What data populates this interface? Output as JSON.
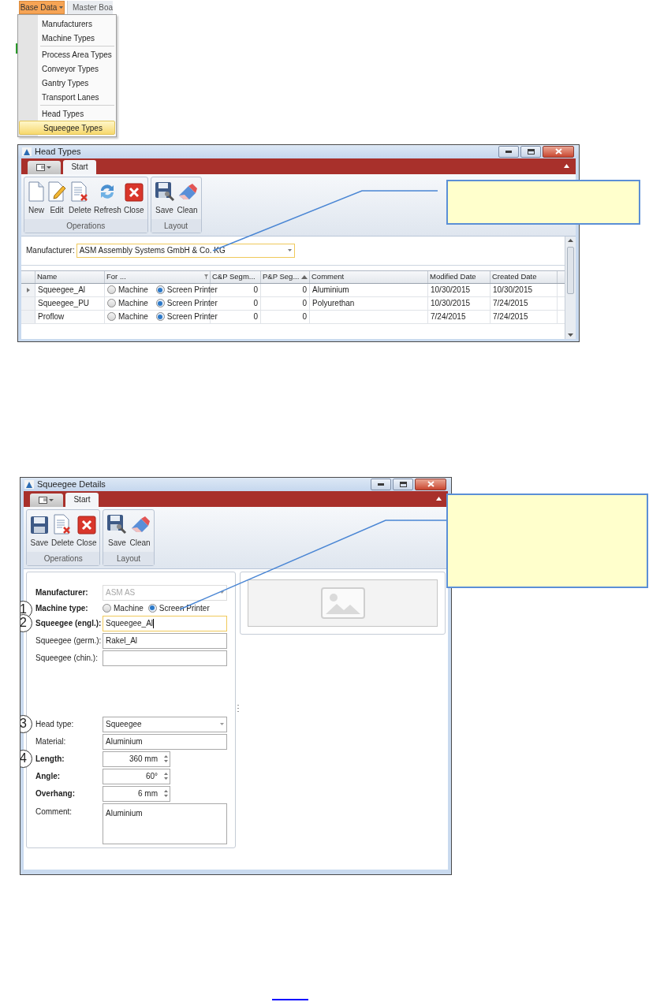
{
  "menu": {
    "button": "Base Data",
    "next_tab": "Master Boa",
    "groups": [
      [
        {
          "label": "Manufacturers",
          "selected": false
        },
        {
          "label": "Machine Types",
          "selected": false
        }
      ],
      [
        {
          "label": "Process Area Types",
          "selected": false
        },
        {
          "label": "Conveyor Types",
          "selected": false
        },
        {
          "label": "Gantry Types",
          "selected": false
        },
        {
          "label": "Transport Lanes",
          "selected": false
        }
      ],
      [
        {
          "label": "Head Types",
          "selected": false
        },
        {
          "label": "Squeegee Types",
          "selected": true
        }
      ]
    ]
  },
  "head_types_window": {
    "title": "Head Types",
    "tab": "Start",
    "ribbon": [
      {
        "label": "Operations",
        "buttons": [
          {
            "label": "New",
            "kind": "new"
          },
          {
            "label": "Edit",
            "kind": "edit"
          },
          {
            "label": "Delete",
            "kind": "delete"
          },
          {
            "label": "Refresh",
            "kind": "refresh"
          },
          {
            "label": "Close",
            "kind": "close"
          }
        ]
      },
      {
        "label": "Layout",
        "buttons": [
          {
            "label": "Save",
            "kind": "save-layout"
          },
          {
            "label": "Clean",
            "kind": "clean"
          }
        ]
      }
    ],
    "manufacturer": {
      "label": "Manufacturer:",
      "value": "ASM Assembly Systems GmbH & Co. KG"
    },
    "table": {
      "columns": [
        {
          "label": "Name",
          "filter": false,
          "sorted": false
        },
        {
          "label": "For ...",
          "filter": true,
          "sorted": false
        },
        {
          "label": "C&P Segm...",
          "filter": false,
          "sorted": false
        },
        {
          "label": "P&P Seg...",
          "filter": false,
          "sorted": true
        },
        {
          "label": "Comment",
          "filter": false,
          "sorted": false
        },
        {
          "label": "Modified Date",
          "filter": false,
          "sorted": false
        },
        {
          "label": "Created Date",
          "filter": false,
          "sorted": false
        }
      ],
      "rows": [
        {
          "current": true,
          "name": "Squeegee_Al",
          "options": [
            {
              "label": "Machine",
              "selected": false
            },
            {
              "label": "Screen Printer",
              "selected": true
            }
          ],
          "cp": "0",
          "pp": "0",
          "comment": "Aluminium",
          "modified": "10/30/2015",
          "created": "10/30/2015"
        },
        {
          "current": false,
          "name": "Squeegee_PU",
          "options": [
            {
              "label": "Machine",
              "selected": false
            },
            {
              "label": "Screen Printer",
              "selected": true
            }
          ],
          "cp": "0",
          "pp": "0",
          "comment": "Polyurethan",
          "modified": "10/30/2015",
          "created": "7/24/2015"
        },
        {
          "current": false,
          "name": "Proflow",
          "options": [
            {
              "label": "Machine",
              "selected": false
            },
            {
              "label": "Screen Printer",
              "selected": true
            }
          ],
          "cp": "0",
          "pp": "0",
          "modified": "7/24/2015",
          "created": "7/24/2015"
        }
      ]
    }
  },
  "details_window": {
    "title": "Squeegee Details",
    "tab": "Start",
    "ribbon": [
      {
        "label": "Operations",
        "buttons": [
          {
            "label": "Save",
            "kind": "save"
          },
          {
            "label": "Delete",
            "kind": "delete"
          },
          {
            "label": "Close",
            "kind": "close"
          }
        ]
      },
      {
        "label": "Layout",
        "buttons": [
          {
            "label": "Save",
            "kind": "save-layout"
          },
          {
            "label": "Clean",
            "kind": "clean"
          }
        ]
      }
    ],
    "sections": [
      [
        {
          "kind": "dropdown",
          "label": "Manufacturer:",
          "bold": true,
          "value": "ASM AS",
          "disabled": true
        },
        {
          "kind": "radio",
          "label": "Machine type:",
          "bold": true,
          "marker": "1",
          "options": [
            {
              "label": "Machine",
              "selected": false
            },
            {
              "label": "Screen Printer",
              "selected": true
            }
          ]
        },
        {
          "kind": "text",
          "label": "Squeegee (engl.):",
          "bold": true,
          "marker": "2",
          "value": "Squeegee_Al",
          "focused": true
        },
        {
          "kind": "text",
          "label": "Squeegee (germ.):",
          "bold": false,
          "value": "Rakel_Al",
          "focused": false
        },
        {
          "kind": "text",
          "label": "Squeegee (chin.):",
          "bold": false,
          "focused": false
        }
      ],
      [
        {
          "kind": "dropdown",
          "label": "Head type:",
          "bold": false,
          "marker": "3",
          "value": "Squeegee",
          "disabled": false
        },
        {
          "kind": "text",
          "label": "Material:",
          "bold": false,
          "value": "Aluminium",
          "focused": false
        },
        {
          "kind": "spin",
          "label": "Length:",
          "bold": true,
          "marker": "4",
          "value": "360 mm"
        },
        {
          "kind": "spin",
          "label": "Angle:",
          "bold": true,
          "value": "60°"
        },
        {
          "kind": "spin",
          "label": "Overhang:",
          "bold": true,
          "value": "6 mm"
        },
        {
          "kind": "textarea",
          "label": "Comment:",
          "bold": false,
          "value": "Aluminium"
        }
      ]
    ]
  }
}
